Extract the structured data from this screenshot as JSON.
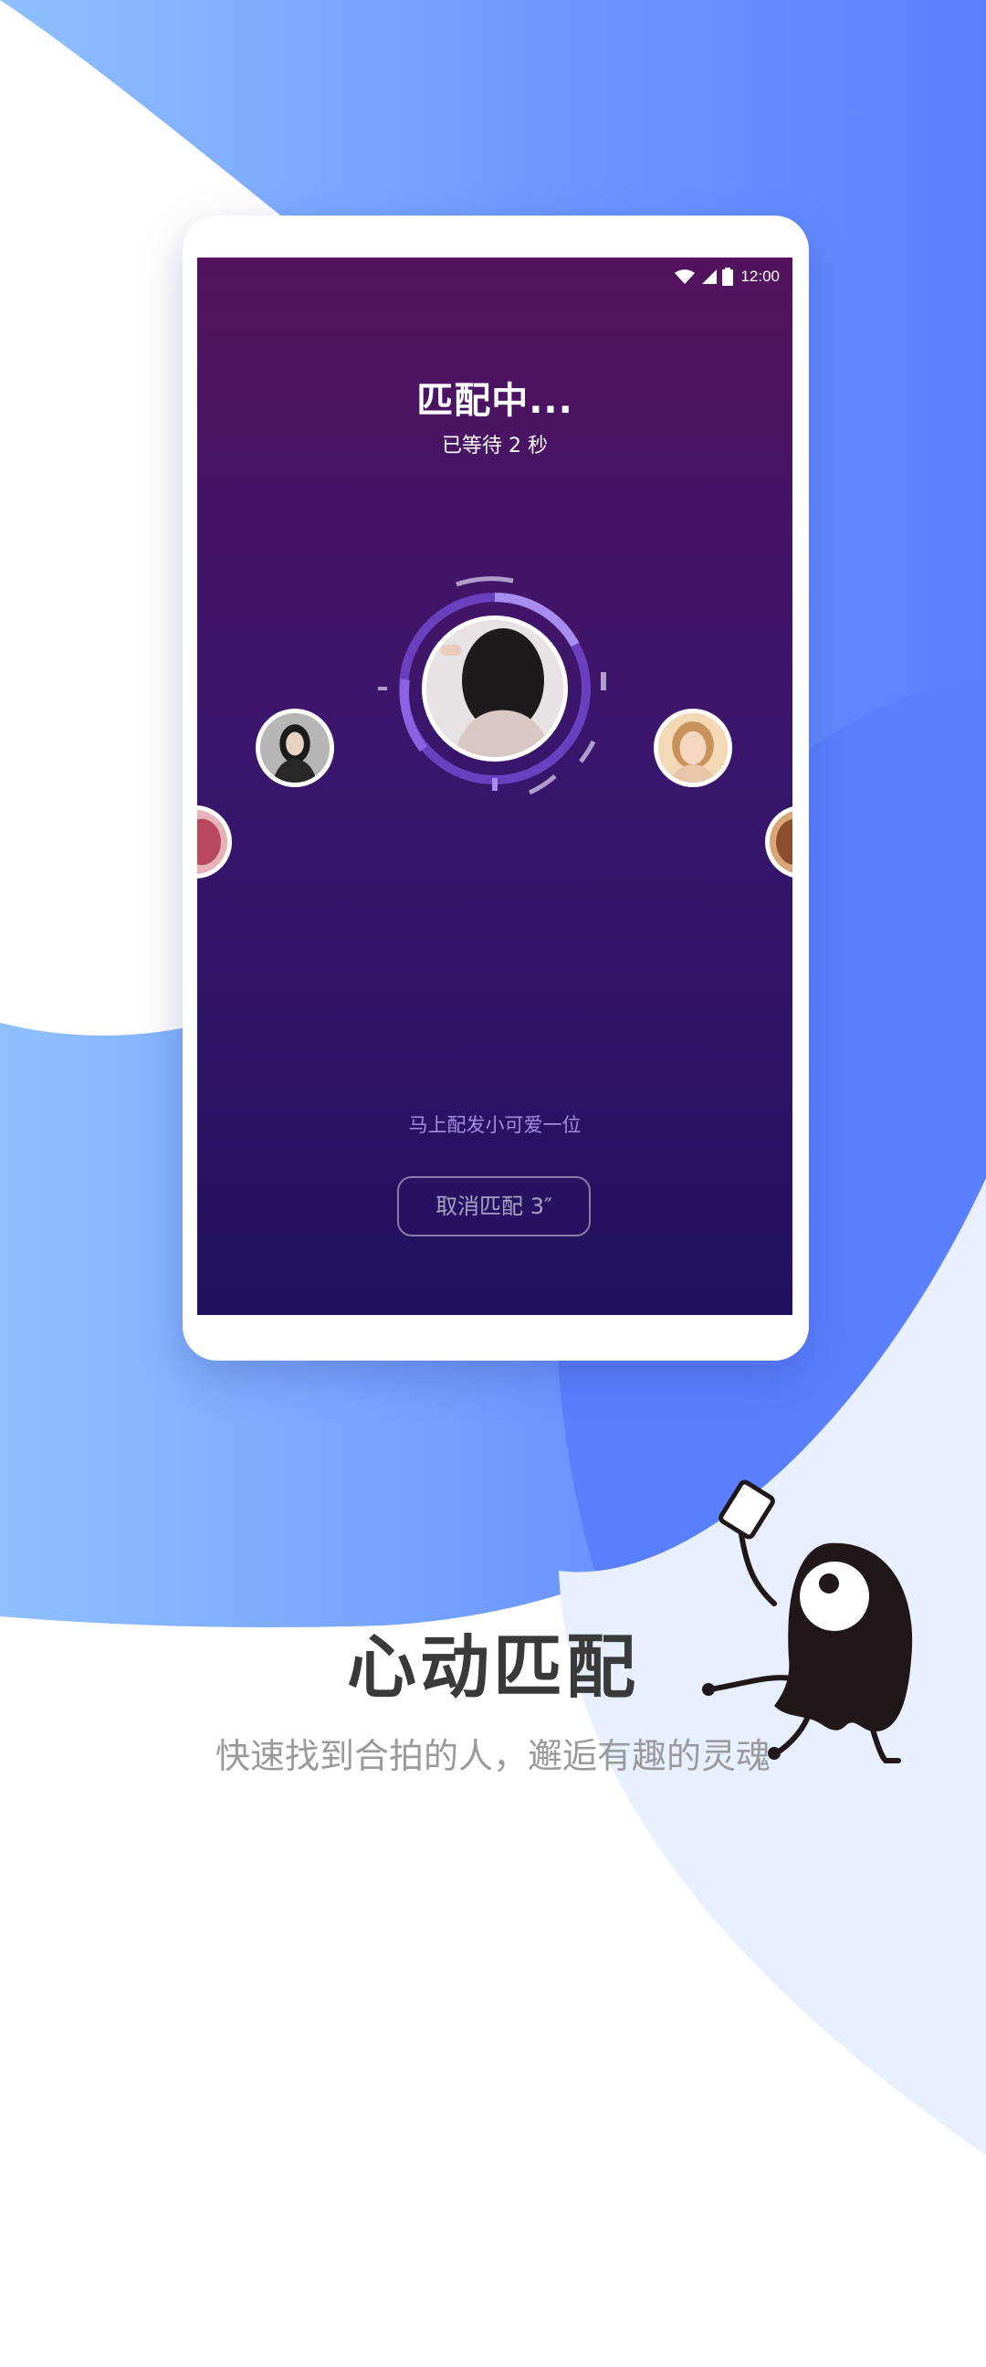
{
  "colors": {
    "blue_light": "#8fc0ff",
    "blue": "#5f87ff",
    "blue_pale": "#e8efff",
    "screen_top": "#53135e",
    "screen_bottom": "#22115f",
    "hint": "#a08ee0",
    "title_dark": "#3a3a3a",
    "subtitle_gray": "#9a9a9a"
  },
  "status_bar": {
    "time": "12:00",
    "icons": [
      "wifi-icon",
      "signal-icon",
      "battery-icon"
    ]
  },
  "matching": {
    "title": "匹配中...",
    "wait_text": "已等待 2 秒",
    "hint": "马上配发小可爱一位",
    "cancel_label": "取消匹配 3″"
  },
  "avatars": [
    "center-avatar",
    "left-avatar",
    "right-avatar",
    "edge-left-avatar",
    "edge-right-avatar"
  ],
  "feature": {
    "title": "心动匹配",
    "subtitle": "快速找到合拍的人，邂逅有趣的灵魂"
  },
  "mascot": {
    "icon": "phone-holding-monster-icon"
  }
}
